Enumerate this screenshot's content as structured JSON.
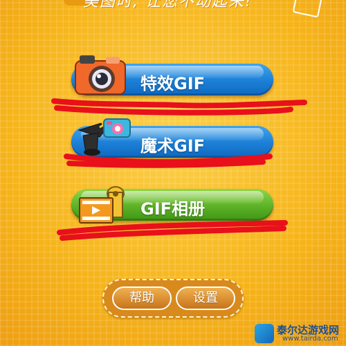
{
  "header": {
    "banner_text": "美图时, 让您不动起来!"
  },
  "menu": {
    "effects_gif_label": "特效GIF",
    "magic_gif_label": "魔术GIF",
    "gif_album_label": "GIF相册"
  },
  "footer": {
    "help_label": "帮助",
    "settings_label": "设置"
  },
  "watermark": {
    "title": "泰尔达游戏网",
    "url": "www.tairda.com"
  },
  "icons": {
    "effects": "camera-icon",
    "magic": "magic-hat-camera-icon",
    "album": "film-album-icon"
  },
  "colors": {
    "background": "#f7b81c",
    "blue_button": "#1c7fd6",
    "green_button": "#5db227",
    "pill_button": "#d98a1c",
    "scribble": "#e8101a"
  }
}
